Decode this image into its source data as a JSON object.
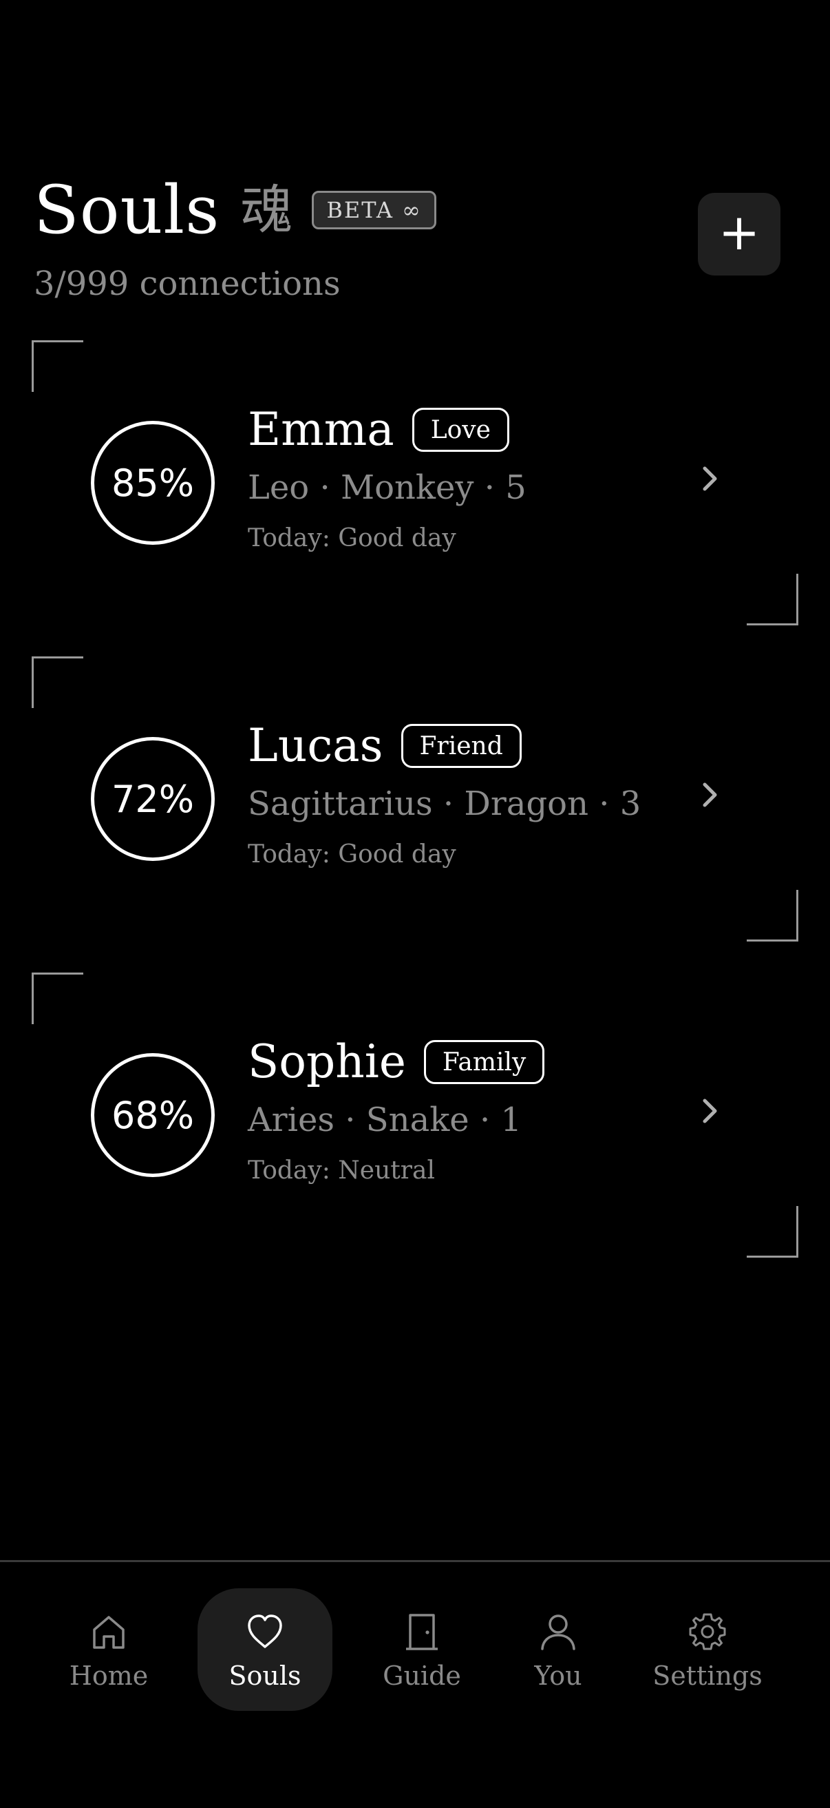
{
  "header": {
    "title": "Souls",
    "kanji": "魂",
    "badge": "BETA ∞",
    "subtitle": "3/999 connections",
    "add_button_label": "+"
  },
  "connections": [
    {
      "score": "85%",
      "score_value": 85,
      "name": "Emma",
      "relation": "Love",
      "meta": "Leo · Monkey · 5",
      "today": "Today: Good day"
    },
    {
      "score": "72%",
      "score_value": 72,
      "name": "Lucas",
      "relation": "Friend",
      "meta": "Sagittarius · Dragon · 3",
      "today": "Today: Good day"
    },
    {
      "score": "68%",
      "score_value": 68,
      "name": "Sophie",
      "relation": "Family",
      "meta": "Aries · Snake · 1",
      "today": "Today: Neutral"
    }
  ],
  "tabbar": {
    "active": "Souls",
    "items": [
      {
        "label": "Home",
        "icon": "home-icon"
      },
      {
        "label": "Souls",
        "icon": "heart-icon"
      },
      {
        "label": "Guide",
        "icon": "door-icon"
      },
      {
        "label": "You",
        "icon": "user-icon"
      },
      {
        "label": "Settings",
        "icon": "gear-icon"
      }
    ]
  },
  "colors": {
    "background": "#000000",
    "text": "#ffffff",
    "muted": "#8c8c8c",
    "active_tab_bg": "#1e1e1e"
  }
}
